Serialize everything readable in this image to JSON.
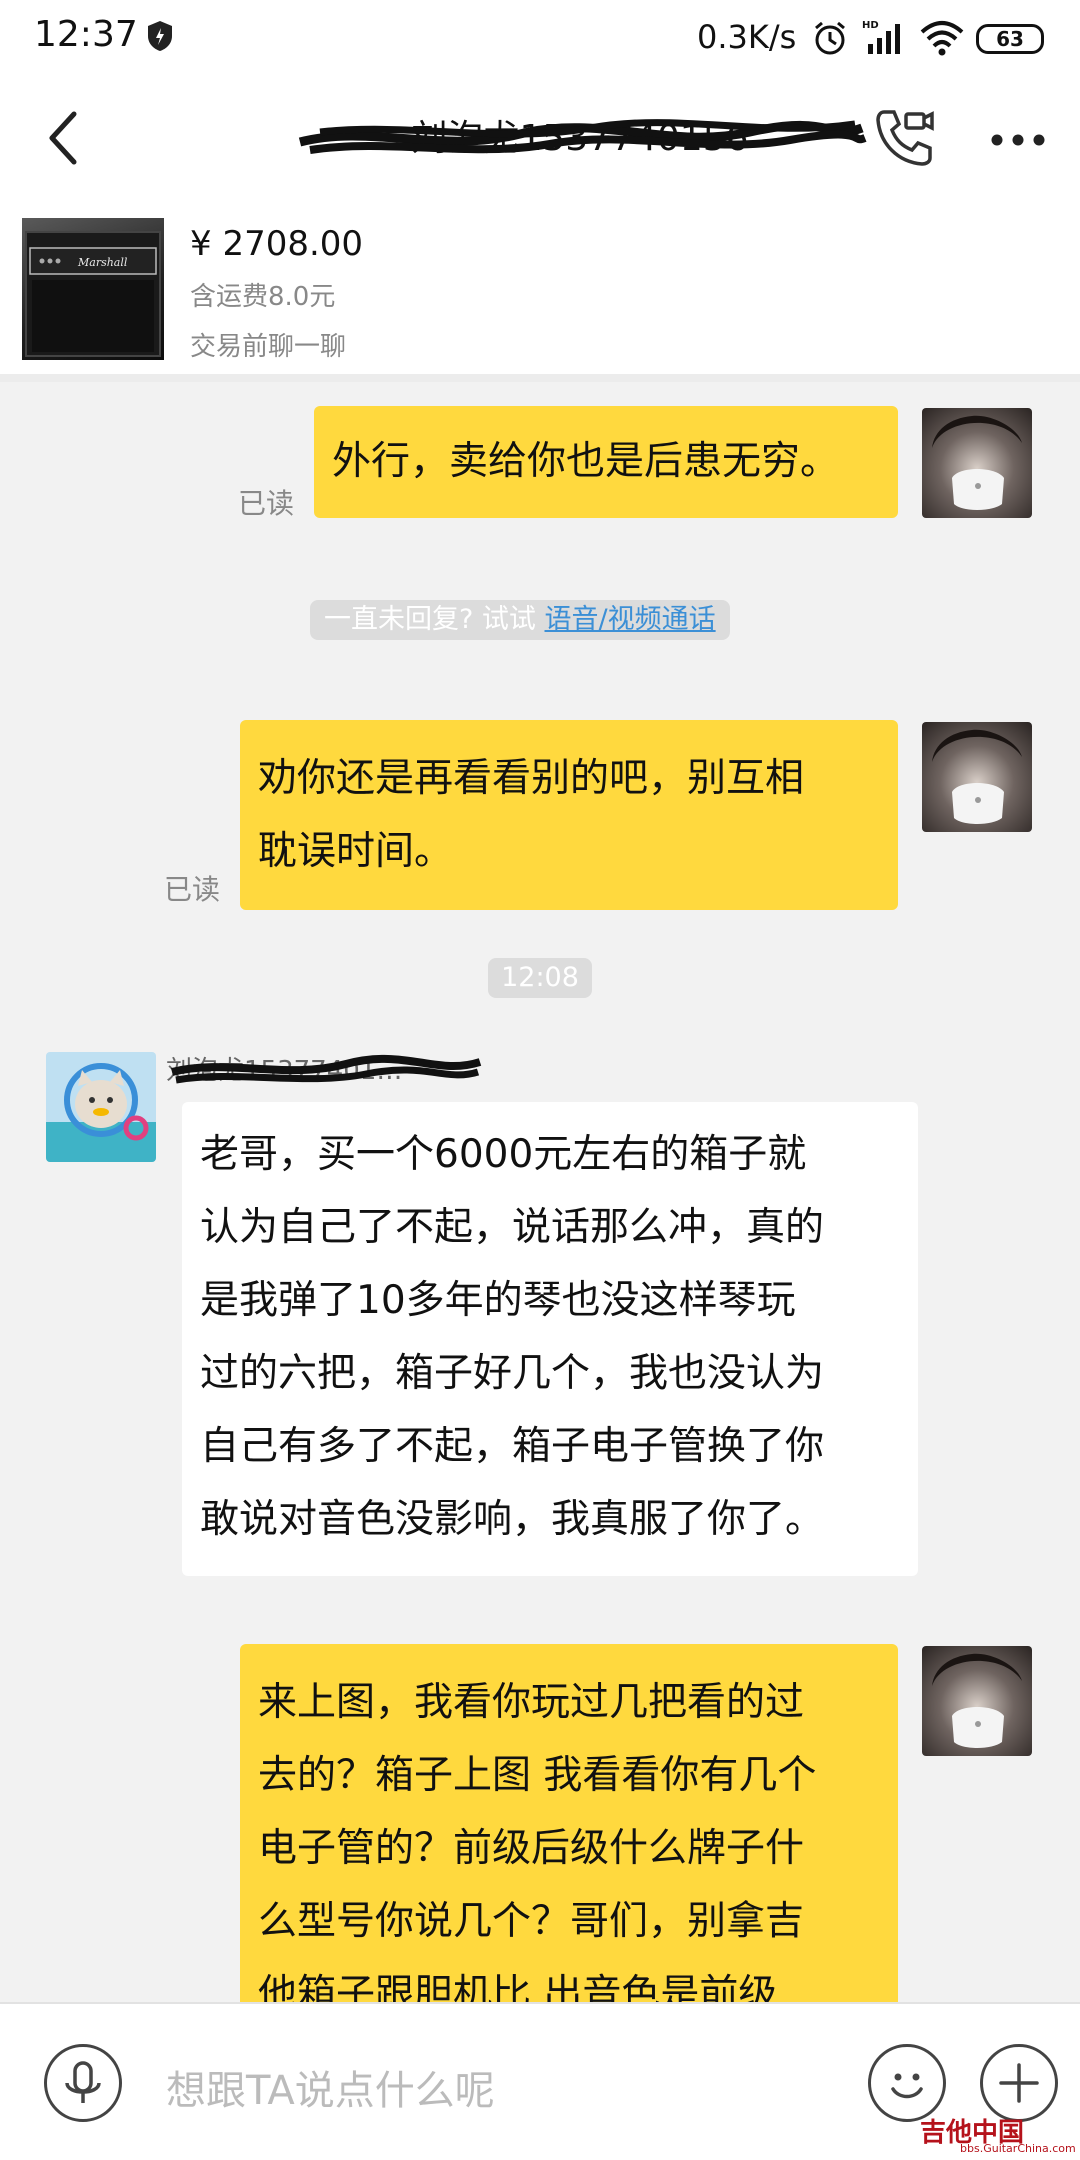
{
  "status_bar": {
    "time": "12:37",
    "net_speed": "0.3K/s",
    "network_badge": "HD",
    "battery": "63",
    "icons": [
      "shield-icon",
      "alarm-icon",
      "signal-icon",
      "wifi-icon",
      "battery-icon"
    ]
  },
  "nav": {
    "back_icon": "chevron-left-icon",
    "title": "刘泡尤1537740156",
    "call_icon": "video-call-icon",
    "more_icon": "more-dots-icon"
  },
  "product": {
    "price": "¥ 2708.00",
    "shipping": "含运费8.0元",
    "chat_before": "交易前聊一聊",
    "brand_text": "Marshall"
  },
  "chat": {
    "messages": [
      {
        "side": "mine",
        "text": "外行，卖给你也是后患无穷。",
        "status": "已读"
      },
      {
        "side": "mine",
        "text": "劝你还是再看看别的吧，别互相\n耽误时间。",
        "status": "已读"
      },
      {
        "side": "theirs",
        "sender": "刘泡尤15377401…",
        "text": "老哥，买一个6000元左右的箱子就\n认为自己了不起，说话那么冲，真的\n是我弹了10多年的琴也没这样琴玩\n过的六把，箱子好几个，我也没认为\n自己有多了不起，箱子电子管换了你\n敢说对音色没影响，我真服了你了。"
      },
      {
        "side": "mine",
        "text": "来上图，我看你玩过几把看的过\n去的？箱子上图 我看看你有几个\n电子管的？前级后级什么牌子什\n么型号你说几个？哥们，别拿吉\n他箱子跟胆机比 出音色是前级"
      }
    ],
    "system_hint_prefix": "一直未回复? 试试 ",
    "system_hint_link": "语音/视频通话",
    "timestamp": "12:08"
  },
  "input_bar": {
    "placeholder": "想跟TA说点什么呢",
    "mic_icon": "microphone-icon",
    "emoji_icon": "emoji-icon",
    "plus_icon": "plus-icon"
  },
  "watermark": {
    "text": "吉他中国",
    "sub": "bbs.GuitarChina.com"
  },
  "colors": {
    "my_bubble": "#ffd93e",
    "their_bubble": "#ffffff",
    "background": "#f2f2f2",
    "link": "#3b8fd6"
  }
}
